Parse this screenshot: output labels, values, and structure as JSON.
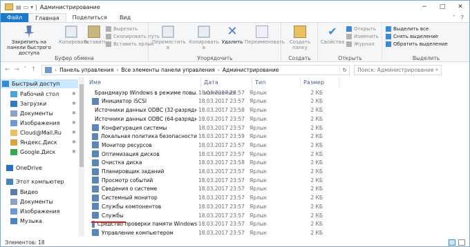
{
  "window": {
    "title": "Администрирование"
  },
  "title_controls": [
    "−",
    "□",
    "✕"
  ],
  "tabs": [
    {
      "label": "Файл"
    },
    {
      "label": "Главная"
    },
    {
      "label": "Поделиться"
    },
    {
      "label": "Вид"
    }
  ],
  "ribbon": {
    "clipboard": {
      "group_label": "Буфер обмена",
      "pin_label": "Закрепить на панели быстрого доступа",
      "copy_label": "Копировать",
      "paste_label": "Вставить",
      "cut_label": "Вырезать",
      "copy_path_label": "Скопировать путь",
      "paste_shortcut_label": "Вставить ярлык"
    },
    "organize": {
      "group_label": "Упорядочить",
      "move_label": "Переместить в",
      "copy_to_label": "Копировать в",
      "delete_label": "Удалить",
      "rename_label": "Переименовать"
    },
    "create": {
      "group_label": "Создать",
      "new_folder_label": "Создать папку"
    },
    "open": {
      "group_label": "Открыть",
      "properties_label": "Свойства",
      "open_label": "Открыть",
      "edit_label": "Изменить",
      "history_label": "Журнал"
    },
    "select": {
      "group_label": "Выделить",
      "select_all_label": "Выделить все",
      "select_none_label": "Снять выделение",
      "invert_label": "Обратить выделение"
    }
  },
  "address": {
    "segments": [
      "Панель управления",
      "Все элементы панели управления",
      "Администрирование"
    ],
    "search_placeholder": "Поиск: Администрирование"
  },
  "navpane": {
    "items": [
      {
        "label": "Быстрый доступ",
        "icon": "star-icon",
        "color": "#3c8ad6",
        "pinned": false
      },
      {
        "label": "Рабочий стол",
        "icon": "desktop-icon",
        "color": "#4aa3df",
        "pinned": true
      },
      {
        "label": "Загрузки",
        "icon": "download-icon",
        "color": "#2f7cc5",
        "pinned": true
      },
      {
        "label": "Документы",
        "icon": "documents-icon",
        "color": "#8ba4c4",
        "pinned": true
      },
      {
        "label": "Изображения",
        "icon": "pictures-icon",
        "color": "#6b9bd2",
        "pinned": true
      },
      {
        "label": "Cloud@Mail.Ru",
        "icon": "folder-icon",
        "color": "#e8c062",
        "pinned": true
      },
      {
        "label": "Яндекс.Диск",
        "icon": "cloud-icon",
        "color": "#e0a23b",
        "pinned": true
      },
      {
        "label": "Google.Диск",
        "icon": "cloud-icon",
        "color": "#34a853",
        "pinned": true
      },
      {
        "label": "OneDrive",
        "icon": "onedrive-icon",
        "color": "#2c6fc4",
        "pinned": false
      },
      {
        "label": "Этот компьютер",
        "icon": "computer-icon",
        "color": "#4a83c2",
        "pinned": false
      },
      {
        "label": "Видео",
        "icon": "video-icon",
        "color": "#5c7ba6",
        "pinned": false
      },
      {
        "label": "Документы",
        "icon": "documents-icon",
        "color": "#8ba4c4",
        "pinned": false
      },
      {
        "label": "Изображения",
        "icon": "pictures-icon",
        "color": "#6b9bd2",
        "pinned": false
      },
      {
        "label": "Музыка",
        "icon": "music-icon",
        "color": "#4e86c5",
        "pinned": false
      }
    ]
  },
  "columns": {
    "name": "Имя",
    "date": "Дата изменения",
    "type": "Тип",
    "size": "Размер"
  },
  "files": [
    {
      "name": "Брандмауэр Windows в режиме повы...",
      "date": "18.03.2017 23:57",
      "type": "Ярлык",
      "size": "2 КБ"
    },
    {
      "name": "Инициатор iSCSI",
      "date": "18.03.2017 23:57",
      "type": "Ярлык",
      "size": "2 КБ"
    },
    {
      "name": "Источники данных ODBC (32-разрядна...",
      "date": "18.03.2017 23:58",
      "type": "Ярлык",
      "size": "2 КБ"
    },
    {
      "name": "Источники данных ODBC (64-разрядна...",
      "date": "18.03.2017 23:57",
      "type": "Ярлык",
      "size": "2 КБ"
    },
    {
      "name": "Конфигурация системы",
      "date": "18.03.2017 23:57",
      "type": "Ярлык",
      "size": "2 КБ"
    },
    {
      "name": "Локальная политика безопасности",
      "date": "18.03.2017 23:59",
      "type": "Ярлык",
      "size": "2 КБ"
    },
    {
      "name": "Монитор ресурсов",
      "date": "18.03.2017 23:57",
      "type": "Ярлык",
      "size": "2 КБ"
    },
    {
      "name": "Оптимизация дисков",
      "date": "18.03.2017 23:57",
      "type": "Ярлык",
      "size": "2 КБ"
    },
    {
      "name": "Очистка диска",
      "date": "18.03.2017 23:58",
      "type": "Ярлык",
      "size": "2 КБ"
    },
    {
      "name": "Планировщик заданий",
      "date": "18.03.2017 23:57",
      "type": "Ярлык",
      "size": "2 КБ"
    },
    {
      "name": "Просмотр событий",
      "date": "18.03.2017 23:57",
      "type": "Ярлык",
      "size": "2 КБ"
    },
    {
      "name": "Сведения о системе",
      "date": "18.03.2017 23:57",
      "type": "Ярлык",
      "size": "2 КБ"
    },
    {
      "name": "Системный монитор",
      "date": "18.03.2017 23:57",
      "type": "Ярлык",
      "size": "2 КБ"
    },
    {
      "name": "Службы компонентов",
      "date": "18.03.2017 23:57",
      "type": "Ярлык",
      "size": "2 КБ"
    },
    {
      "name": "Службы",
      "date": "18.03.2017 23:57",
      "type": "Ярлык",
      "size": "2 КБ"
    },
    {
      "name": "Средство проверки памяти Windows",
      "date": "18.03.2017 23:57",
      "type": "Ярлык",
      "size": "2 КБ"
    },
    {
      "name": "Управление компьютером",
      "date": "18.03.2017 23:57",
      "type": "Ярлык",
      "size": "2 КБ"
    }
  ],
  "status": {
    "count_text": "Элементов: 18"
  }
}
